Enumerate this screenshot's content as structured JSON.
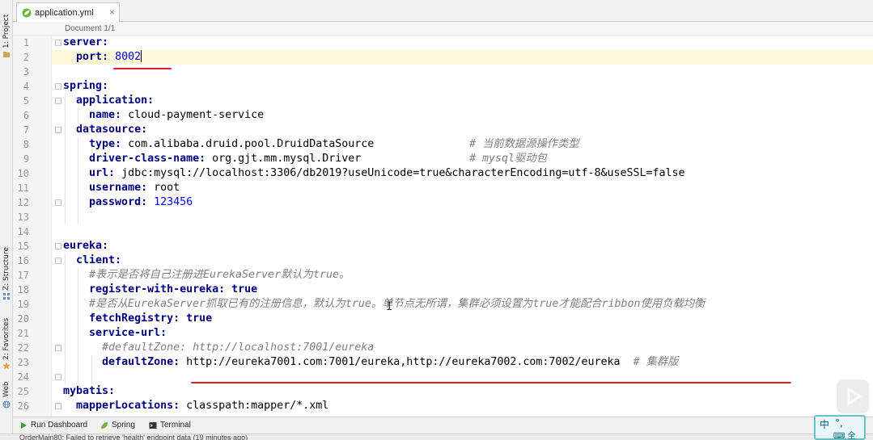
{
  "tool_window_stripes": {
    "project": "1: Project",
    "structure": "Z: Structure",
    "favorites": "2: Favorites",
    "web": "Web"
  },
  "editor_tab": {
    "filename": "application.yml",
    "close_glyph": "×",
    "icon": "spring-leaf-icon"
  },
  "breadcrumb": {
    "text": "Document 1/1"
  },
  "code_lines": [
    {
      "n": "1"
    },
    {
      "n": "2"
    },
    {
      "n": "3"
    },
    {
      "n": "4"
    },
    {
      "n": "5"
    },
    {
      "n": "6"
    },
    {
      "n": "7"
    },
    {
      "n": "8"
    },
    {
      "n": "9"
    },
    {
      "n": "10"
    },
    {
      "n": "11"
    },
    {
      "n": "12"
    },
    {
      "n": "13"
    },
    {
      "n": "14"
    },
    {
      "n": "15"
    },
    {
      "n": "16"
    },
    {
      "n": "17"
    },
    {
      "n": "18"
    },
    {
      "n": "19"
    },
    {
      "n": "20"
    },
    {
      "n": "21"
    },
    {
      "n": "22"
    },
    {
      "n": "23"
    },
    {
      "n": "24"
    },
    {
      "n": "25"
    },
    {
      "n": "26"
    }
  ],
  "code": {
    "l1_key": "server:",
    "l2_key": "port: ",
    "l2_val": "8002",
    "l4_key": "spring:",
    "l5_key": "application:",
    "l6_key": "name: ",
    "l6_val": "cloud-payment-service",
    "l7_key": "datasource:",
    "l8_key": "type: ",
    "l8_val": "com.alibaba.druid.pool.DruidDataSource",
    "l8_cm": "# 当前数据源操作类型",
    "l9_key": "driver-class-name: ",
    "l9_val": "org.gjt.mm.mysql.Driver",
    "l9_cm": "# mysql驱动包",
    "l10_key": "url: ",
    "l10_val": "jdbc:mysql://localhost:3306/db2019?useUnicode=true&characterEncoding=utf-8&useSSL=false",
    "l11_key": "username: ",
    "l11_val": "root",
    "l12_key": "password: ",
    "l12_val": "123456",
    "l15_key": "eureka:",
    "l16_key": "client:",
    "l17_cm": "#表示是否将自己注册进EurekaServer默认为true。",
    "l18_key": "register-with-eureka: ",
    "l18_val": "true",
    "l19_cm": "#是否从EurekaServer抓取已有的注册信息，默认为true。单节点无所谓，集群必须设置为true才能配合ribbon使用负载均衡",
    "l20_key": "fetchRegistry: ",
    "l20_val": "true",
    "l21_key": "service-url:",
    "l22_cm": "#defaultZone: http://localhost:7001/eureka",
    "l23_key": "defaultZone: ",
    "l23_val": "http://eureka7001.com:7001/eureka,http://eureka7002.com:7002/eureka",
    "l23_cm": "# 集群版",
    "l25_key": "mybatis:",
    "l26_key": "mapperLocations: ",
    "l26_val": "classpath:mapper/*.xml"
  },
  "bottom_toolbar": {
    "run_dashboard": "Run Dashboard",
    "spring": "Spring",
    "terminal": "Terminal"
  },
  "status_message": "OrderMain80: Failed to retrieve 'health' endpoint data (19 minutes ago)",
  "ime_indicator": {
    "lang": "中",
    "mode": "°,",
    "extra": "⌨ 全"
  },
  "colors": {
    "key": "#000080",
    "number": "#0000ff",
    "comment": "#808080",
    "annotation": "#e02020",
    "caret_line": "#fdf8dc"
  }
}
